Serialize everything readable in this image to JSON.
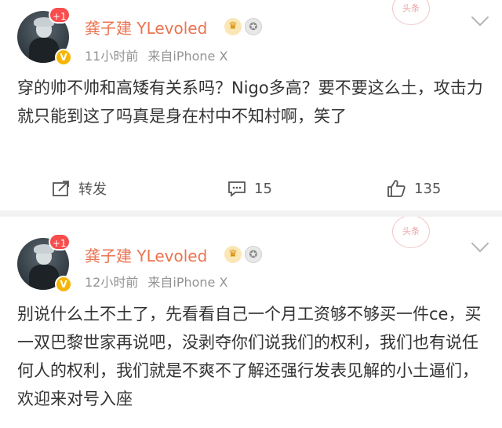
{
  "posts": [
    {
      "author": "龚子建 YLevoled",
      "badge_count": "+1",
      "vip_icon": "crown-vip-icon",
      "medal_icon": "medal-icon",
      "time": "11小时前",
      "source": "来自iPhone X",
      "text": "穿的帅不帅和高矮有关系吗？Nigo多高？要不要这么土，攻击力就只能到这了吗真是身在村中不知村啊，笑了",
      "actions": {
        "repost_label": "转发",
        "comment_count": "15",
        "like_count": "135"
      }
    },
    {
      "author": "龚子建 YLevoled",
      "badge_count": "+1",
      "vip_icon": "crown-vip-icon",
      "medal_icon": "medal-icon",
      "time": "12小时前",
      "source": "来自iPhone X",
      "text": "别说什么土不土了，先看看自己一个月工资够不够买一件ce，买一双巴黎世家再说吧，没剥夺你们说我们的权利，我们也有说任何人的权利，我们就是不爽不了解还强行发表见解的小土逼们，欢迎来对号入座"
    }
  ],
  "colors": {
    "username": "#eb7350",
    "meta": "#939393",
    "text": "#333333",
    "badge": "#f74d4d",
    "verified": "#f7b500"
  }
}
